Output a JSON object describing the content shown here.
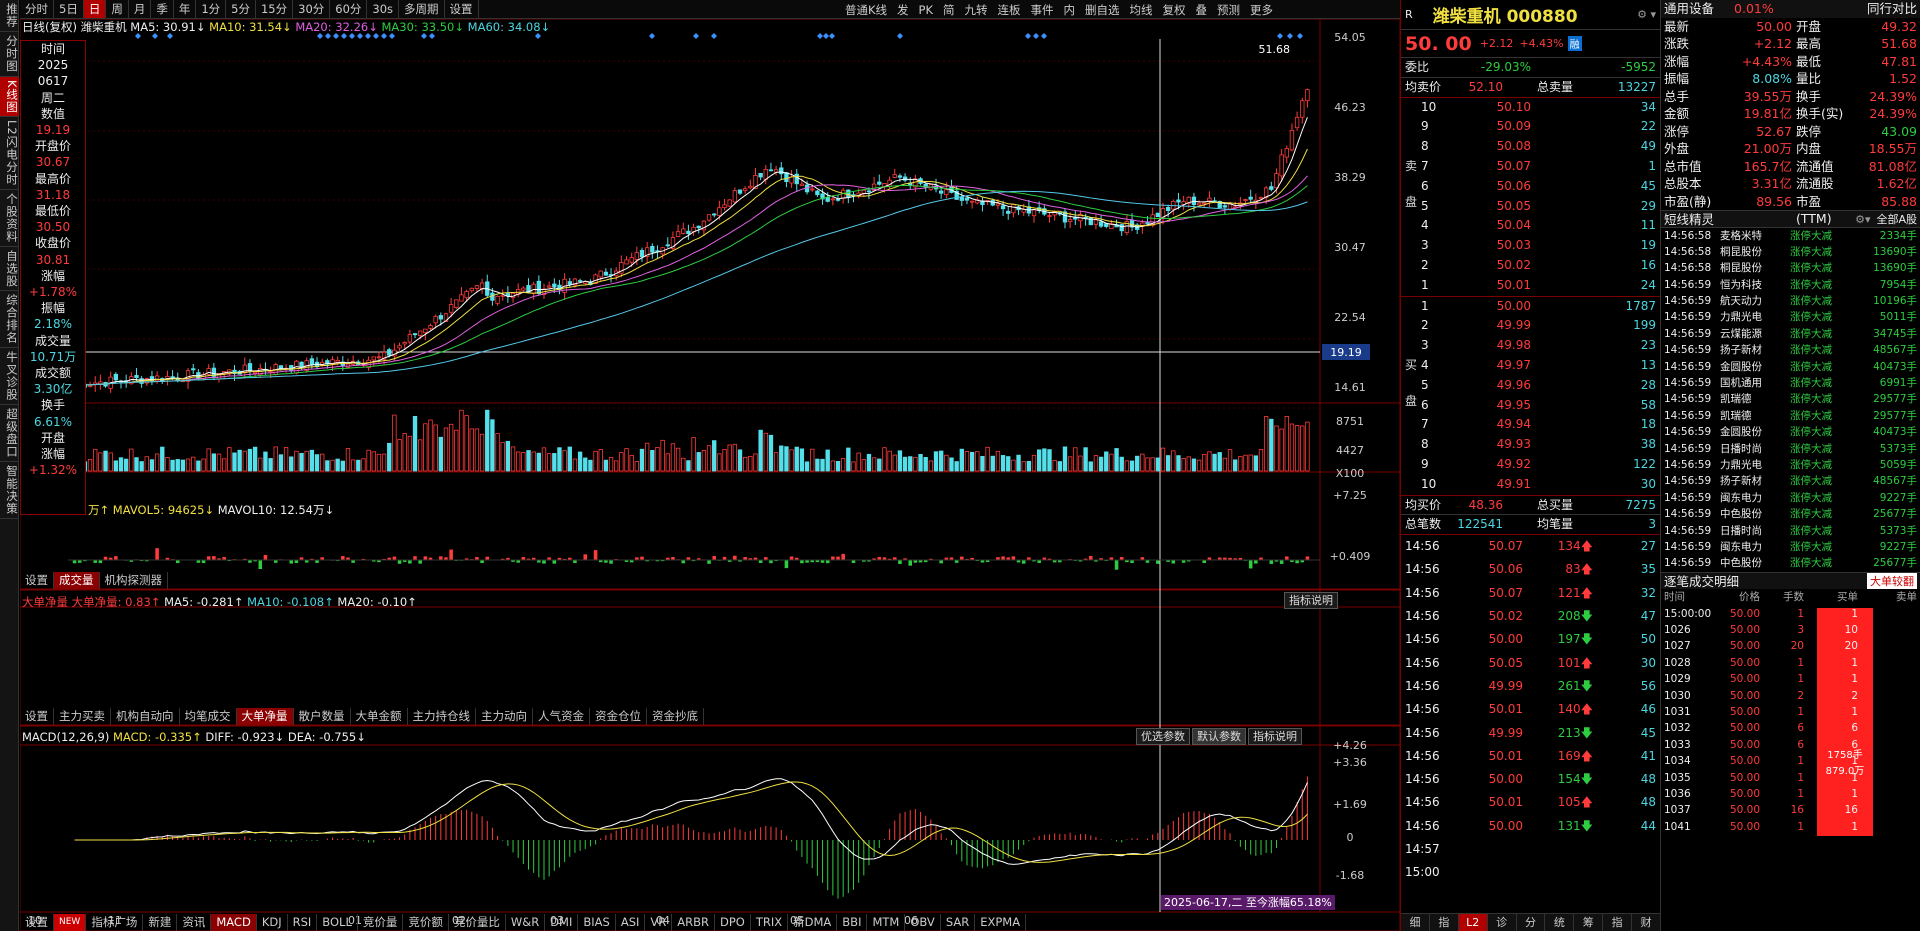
{
  "leftnav": [
    "推荐",
    "分时图",
    "K线图",
    "L2闪电分时",
    "个股资料",
    "自选股",
    "综合排名",
    "牛叉诊股",
    "超级盘口",
    "智能决策"
  ],
  "toolbar": {
    "items": [
      "分时",
      "5日",
      "日",
      "周",
      "月",
      "季",
      "年",
      "1分",
      "5分",
      "15分",
      "30分",
      "60分",
      "30s",
      "多周期",
      "设置"
    ],
    "active": "日"
  },
  "toolbar2": [
    "普通K线",
    "发",
    "PK",
    "简",
    "九转",
    "连板",
    "事件",
    "内",
    "删自选",
    "均线",
    "复权",
    "叠",
    "预测",
    "更多"
  ],
  "chart_header": {
    "title": "日线(复权)",
    "name": "潍柴重机",
    "ma5": "MA5: 30.91↓",
    "ma10": "MA10: 31.54↓",
    "ma20": "MA20: 32.26↓",
    "ma30": "MA30: 33.50↓",
    "ma60": "MA60: 34.08↓"
  },
  "infobox": [
    {
      "label": "时间",
      "value": "2025",
      "cls": "wht"
    },
    {
      "label": "",
      "value": "0617",
      "cls": "wht"
    },
    {
      "label": "",
      "value": "周二",
      "cls": "wht"
    },
    {
      "label": "数值",
      "value": "19.19",
      "cls": "red"
    },
    {
      "label": "开盘价",
      "value": "30.67",
      "cls": "red"
    },
    {
      "label": "最高价",
      "value": "31.18",
      "cls": "red"
    },
    {
      "label": "最低价",
      "value": "30.50",
      "cls": "red"
    },
    {
      "label": "收盘价",
      "value": "30.81",
      "cls": "red"
    },
    {
      "label": "涨幅",
      "value": "+1.78%",
      "cls": "red"
    },
    {
      "label": "振幅",
      "value": "2.18%",
      "cls": "cyan"
    },
    {
      "label": "成交量",
      "value": "10.71万",
      "cls": "cyan"
    },
    {
      "label": "成交额",
      "value": "3.30亿",
      "cls": "cyan"
    },
    {
      "label": "换手",
      "value": "6.61%",
      "cls": "cyan"
    },
    {
      "label": "开盘",
      "value": "",
      "cls": "wht"
    },
    {
      "label": "涨幅",
      "value": "+1.32%",
      "cls": "red"
    }
  ],
  "price_axis": [
    "54.05",
    "46.23",
    "38.29",
    "30.47",
    "22.54",
    "14.61"
  ],
  "crosshair_value": "19.19",
  "high_marker": "51.68",
  "vol_header": {
    "a": "万↑",
    "b": "MAVOL5: 94625↓",
    "c": "MAVOL10: 12.54万↓"
  },
  "vol_axis": [
    "8751",
    "4427",
    "X100"
  ],
  "tabs1": [
    "设置",
    "成交量",
    "机构探测器"
  ],
  "flow_header": {
    "name": "大单净量",
    "v": "大单净量: 0.83↑",
    "ma5": "MA5: -0.281↑",
    "ma10": "MA10: -0.108↑",
    "ma20": "MA20: -0.10↑"
  },
  "flow_axis": [
    "+7.25",
    "+0.409"
  ],
  "indicator_btn": "指标说明",
  "tabs2": [
    "设置",
    "主力买卖",
    "机构自动向",
    "均笔成交",
    "大单净量",
    "散户数量",
    "大单金额",
    "主力持仓线",
    "主力动向",
    "人气资金",
    "资金仓位",
    "资金抄底"
  ],
  "macd_header": {
    "name": "MACD(12,26,9)",
    "macd": "MACD: -0.335↑",
    "diff": "DIFF: -0.923↓",
    "dea": "DEA: -0.755↓"
  },
  "macd_buttons": [
    "优选参数",
    "默认参数",
    "指标说明"
  ],
  "macd_axis": [
    "+4.26",
    "+3.36",
    "+1.69",
    "0",
    "-1.68"
  ],
  "months": [
    "10",
    "11",
    "12",
    "01",
    "02",
    "03",
    "04",
    "05",
    "06"
  ],
  "date_tag": "2025-06-17,二 至今涨幅65.18%",
  "tabs3": [
    "设置",
    "NEW",
    "指标广场",
    "新建",
    "资讯",
    "MACD",
    "KDJ",
    "RSI",
    "BOLL",
    "竞价量",
    "竞价额",
    "竞价量比",
    "W&R",
    "DMI",
    "BIAS",
    "ASI",
    "VR",
    "ARBR",
    "DPO",
    "TRIX",
    "新DMA",
    "BBI",
    "MTM",
    "OBV",
    "SAR",
    "EXPMA"
  ],
  "quote": {
    "code_prefix": "R",
    "name": "潍柴重机 000880",
    "price": "50. 00",
    "chg": "+2.12",
    "pct": "+4.43%",
    "tag": "融",
    "weibi_label": "委比",
    "weibi": "-29.03%",
    "weicha": "-5952",
    "avg_sell_label": "均卖价",
    "avg_sell": "52.10",
    "total_sell_label": "总卖量",
    "total_sell": "13227",
    "sell": [
      [
        "10",
        "50.10",
        "34"
      ],
      [
        "9",
        "50.09",
        "22"
      ],
      [
        "8",
        "50.08",
        "49"
      ],
      [
        "7",
        "50.07",
        "1"
      ],
      [
        "6",
        "50.06",
        "45"
      ],
      [
        "5",
        "50.05",
        "29"
      ],
      [
        "4",
        "50.04",
        "11"
      ],
      [
        "3",
        "50.03",
        "19"
      ],
      [
        "2",
        "50.02",
        "16"
      ],
      [
        "1",
        "50.01",
        "24"
      ]
    ],
    "buy": [
      [
        "1",
        "50.00",
        "1787"
      ],
      [
        "2",
        "49.99",
        "199"
      ],
      [
        "3",
        "49.98",
        "23"
      ],
      [
        "4",
        "49.97",
        "13"
      ],
      [
        "5",
        "49.96",
        "28"
      ],
      [
        "6",
        "49.95",
        "58"
      ],
      [
        "7",
        "49.94",
        "18"
      ],
      [
        "8",
        "49.93",
        "38"
      ],
      [
        "9",
        "49.92",
        "122"
      ],
      [
        "10",
        "49.91",
        "30"
      ]
    ],
    "sell_label": "卖盘",
    "buy_label": "买盘",
    "avg_buy_label": "均买价",
    "avg_buy": "48.36",
    "total_buy_label": "总买量",
    "total_buy": "7275",
    "total_trades_label": "总笔数",
    "total_trades": "122541",
    "avg_trade_label": "均笔量",
    "avg_trade": "3",
    "ticks": [
      [
        "14:56",
        "50.07",
        "134",
        "up",
        "27"
      ],
      [
        "14:56",
        "50.06",
        "83",
        "up",
        "35"
      ],
      [
        "14:56",
        "50.07",
        "121",
        "up",
        "32"
      ],
      [
        "14:56",
        "50.02",
        "208",
        "dn",
        "47"
      ],
      [
        "14:56",
        "50.00",
        "197",
        "dn",
        "50"
      ],
      [
        "14:56",
        "50.05",
        "101",
        "up",
        "30"
      ],
      [
        "14:56",
        "49.99",
        "261",
        "dn",
        "56"
      ],
      [
        "14:56",
        "50.01",
        "140",
        "up",
        "46"
      ],
      [
        "14:56",
        "49.99",
        "213",
        "dn",
        "45"
      ],
      [
        "14:56",
        "50.01",
        "169",
        "up",
        "41"
      ],
      [
        "14:56",
        "50.00",
        "154",
        "dn",
        "48"
      ],
      [
        "14:56",
        "50.01",
        "105",
        "up",
        "48"
      ],
      [
        "14:56",
        "50.00",
        "131",
        "dn",
        "44"
      ],
      [
        "14:57",
        "",
        "",
        "",
        ""
      ],
      [
        "15:00",
        "",
        "",
        "",
        ""
      ]
    ],
    "bottom_tabs": [
      "细",
      "指",
      "L2",
      "诊",
      "分",
      "统",
      "筹",
      "指",
      "财"
    ]
  },
  "market": {
    "top_left": "通用设备",
    "top_pct": "0.01%",
    "top_right": "同行对比",
    "rows": [
      [
        "最新",
        "50.00",
        "开盘",
        "49.32"
      ],
      [
        "涨跌",
        "+2.12",
        "最高",
        "51.68"
      ],
      [
        "涨幅",
        "+4.43%",
        "最低",
        "47.81"
      ],
      [
        "振幅",
        "8.08%",
        "量比",
        "1.52"
      ],
      [
        "总手",
        "39.55万",
        "换手",
        "24.39%"
      ],
      [
        "金额",
        "19.81亿",
        "换手(实)",
        "24.39%"
      ],
      [
        "涨停",
        "52.67",
        "跌停",
        "43.09"
      ],
      [
        "外盘",
        "21.00万",
        "内盘",
        "18.55万"
      ],
      [
        "总市值",
        "165.7亿",
        "流通值",
        "81.08亿"
      ],
      [
        "总股本",
        "3.31亿",
        "流通股",
        "1.62亿"
      ],
      [
        "市盈(静)",
        "89.56",
        "市盈(TTM)",
        "85.88"
      ]
    ],
    "feed_title": "短线精灵",
    "feed_right": "全部A股",
    "feed": [
      [
        "14:56:58",
        "麦格米特",
        "涨停大减",
        "2334手"
      ],
      [
        "14:56:58",
        "桐昆股份",
        "涨停大减",
        "13690手"
      ],
      [
        "14:56:58",
        "桐昆股份",
        "涨停大减",
        "13690手"
      ],
      [
        "14:56:59",
        "恒为科技",
        "涨停大减",
        "7954手"
      ],
      [
        "14:56:59",
        "航天动力",
        "涨停大减",
        "10196手"
      ],
      [
        "14:56:59",
        "力鼎光电",
        "涨停大减",
        "5011手"
      ],
      [
        "14:56:59",
        "云煤能源",
        "涨停大减",
        "34745手"
      ],
      [
        "14:56:59",
        "扬子新材",
        "涨停大减",
        "48567手"
      ],
      [
        "14:56:59",
        "金圆股份",
        "涨停大减",
        "40473手"
      ],
      [
        "14:56:59",
        "国机通用",
        "涨停大减",
        "6991手"
      ],
      [
        "14:56:59",
        "凯瑞德",
        "涨停大减",
        "29577手"
      ],
      [
        "14:56:59",
        "凯瑞德",
        "涨停大减",
        "29577手"
      ],
      [
        "14:56:59",
        "金圆股份",
        "涨停大减",
        "40473手"
      ],
      [
        "14:56:59",
        "日播时尚",
        "涨停大减",
        "5373手"
      ],
      [
        "14:56:59",
        "力鼎光电",
        "涨停大减",
        "5059手"
      ],
      [
        "14:56:59",
        "扬子新材",
        "涨停大减",
        "48567手"
      ],
      [
        "14:56:59",
        "闽东电力",
        "涨停大减",
        "9227手"
      ],
      [
        "14:56:59",
        "中色股份",
        "涨停大减",
        "25677手"
      ],
      [
        "14:56:59",
        "日播时尚",
        "涨停大减",
        "5373手"
      ],
      [
        "14:56:59",
        "闽东电力",
        "涨停大减",
        "9227手"
      ],
      [
        "14:56:59",
        "中色股份",
        "涨停大减",
        "25677手"
      ]
    ],
    "trade_title": "逐笔成交明细",
    "trade_btn": "大单较翻",
    "trade_headers": [
      "时间",
      "价格",
      "手数",
      "买单",
      "卖单"
    ],
    "trades": [
      [
        "15:00:00",
        "50.00",
        "1",
        "1",
        ""
      ],
      [
        "1026",
        "50.00",
        "3",
        "10",
        ""
      ],
      [
        "1027",
        "50.00",
        "20",
        "20",
        ""
      ],
      [
        "1028",
        "50.00",
        "1",
        "1",
        ""
      ],
      [
        "1029",
        "50.00",
        "1",
        "1",
        ""
      ],
      [
        "1030",
        "50.00",
        "2",
        "2",
        ""
      ],
      [
        "1031",
        "50.00",
        "1",
        "1",
        ""
      ],
      [
        "1032",
        "50.00",
        "6",
        "6",
        ""
      ],
      [
        "1033",
        "50.00",
        "6",
        "6",
        ""
      ],
      [
        "1034",
        "50.00",
        "1",
        "1",
        ""
      ],
      [
        "1035",
        "50.00",
        "1",
        "1",
        ""
      ],
      [
        "1036",
        "50.00",
        "1",
        "1",
        ""
      ],
      [
        "1037",
        "50.00",
        "16",
        "16",
        ""
      ],
      [
        "1041",
        "50.00",
        "1",
        "1",
        ""
      ]
    ],
    "big_order_qty": "1758手",
    "big_order_amt": "879.0万"
  },
  "colors": {
    "up": "#ff3b3b",
    "down": "#2ecc40",
    "cyan": "#54e0ea",
    "accent": "#b00000"
  }
}
